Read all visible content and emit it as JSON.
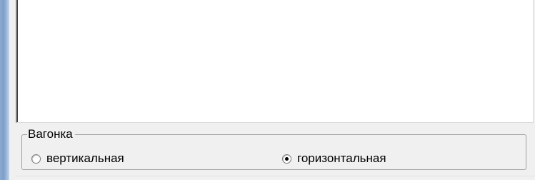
{
  "groupbox": {
    "title": "Вагонка",
    "options": [
      {
        "label": "вертикальная",
        "checked": false
      },
      {
        "label": "горизонтальная",
        "checked": true
      }
    ]
  }
}
